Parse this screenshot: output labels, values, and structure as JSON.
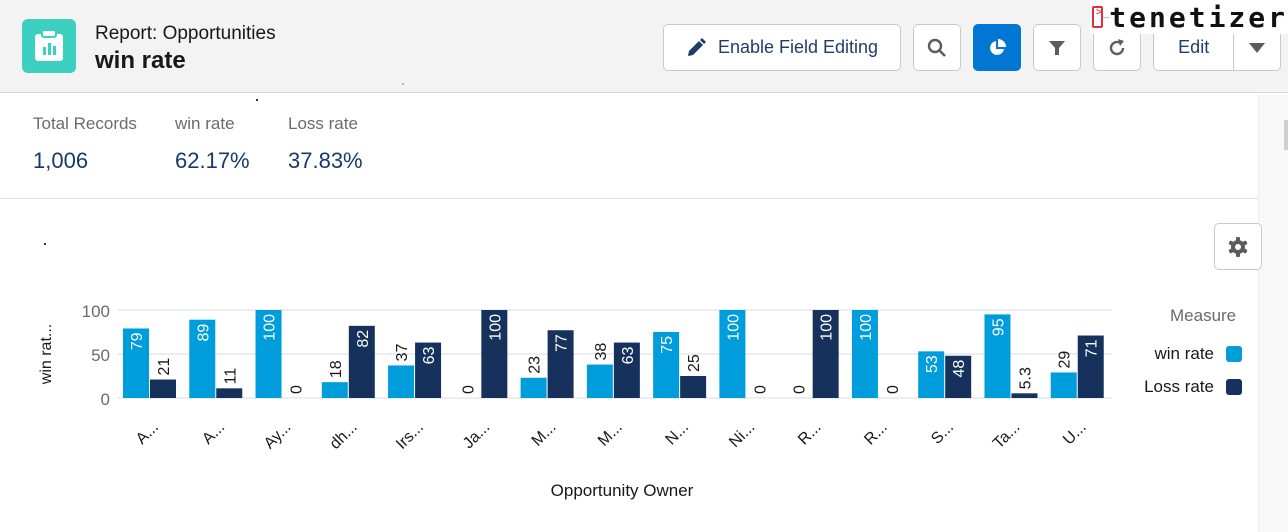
{
  "header": {
    "eyebrow": "Report: Opportunities",
    "title": "win rate",
    "app_icon": "report-icon",
    "buttons": {
      "enable_field_editing": "Enable Field Editing",
      "search_icon": "search-icon",
      "chart_icon": "pie-chart-icon",
      "filter_icon": "filter-icon",
      "refresh_icon": "refresh-icon",
      "edit": "Edit",
      "edit_menu_icon": "caret-down-icon"
    },
    "brand": "tenetizer"
  },
  "summary": [
    {
      "label": "Total Records",
      "value": "1,006"
    },
    {
      "label": "win rate",
      "value": "62.17%"
    },
    {
      "label": "Loss rate",
      "value": "37.83%"
    }
  ],
  "colors": {
    "win_rate": "#009ddc",
    "loss_rate": "#16325c",
    "accent": "#0176d3",
    "app_icon": "#3cd0c0"
  },
  "chart_data": {
    "type": "bar",
    "title": "",
    "xlabel": "Opportunity Owner",
    "ylabel": "win rat...",
    "ylim": [
      0,
      100
    ],
    "yticks": [
      0,
      50,
      100
    ],
    "grid": true,
    "legend_title": "Measure",
    "legend_position": "right",
    "categories": [
      "A...",
      "A...",
      "Ay...",
      "dh...",
      "Irs...",
      "Ja...",
      "M...",
      "M...",
      "N...",
      "Ni...",
      "R...",
      "R...",
      "S...",
      "Ta...",
      "U..."
    ],
    "series": [
      {
        "name": "win rate",
        "color": "#009ddc",
        "values": [
          79,
          89,
          100,
          18,
          37,
          0,
          23,
          38,
          75,
          100,
          0,
          100,
          53,
          95,
          29
        ]
      },
      {
        "name": "Loss rate",
        "color": "#16325c",
        "values": [
          21,
          11,
          0,
          82,
          63,
          100,
          77,
          63,
          25,
          0,
          100,
          0,
          48,
          5.3,
          71
        ]
      }
    ]
  }
}
